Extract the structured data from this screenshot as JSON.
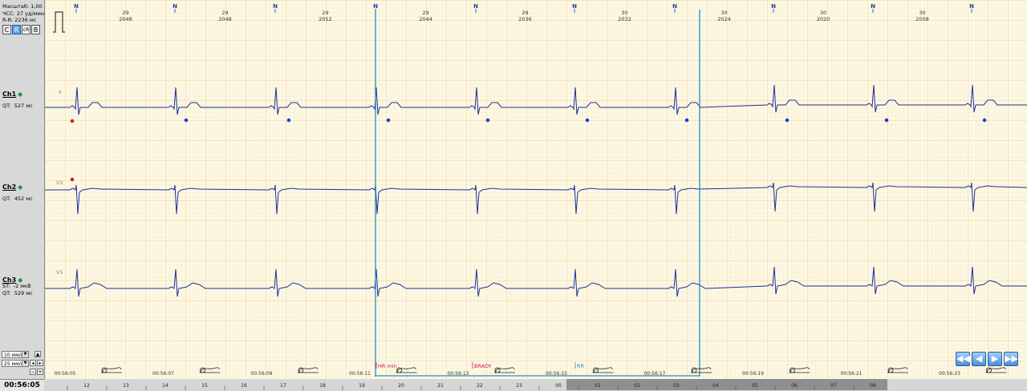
{
  "info": {
    "scale_label": "Масштаб:",
    "scale_value": "1,00",
    "hr_label": "ЧСС:",
    "hr_value": "27",
    "hr_unit": "уд/мин",
    "rr_label": "R-R:",
    "rr_value": "2236",
    "rr_unit": "мс"
  },
  "mode_buttons": [
    "C",
    "R",
    "cR",
    "B"
  ],
  "channels": [
    {
      "name": "Ch1",
      "lead": "II",
      "meas": [
        {
          "label": "QT:",
          "value": "527",
          "unit": "мс"
        }
      ]
    },
    {
      "name": "Ch2",
      "lead": "V2",
      "meas": [
        {
          "label": "QT:",
          "value": "452",
          "unit": "мс"
        }
      ]
    },
    {
      "name": "Ch3",
      "lead": "V5",
      "meas": [
        {
          "label": "ST:",
          "value": "-2",
          "unit": "мкВ"
        },
        {
          "label": "QT:",
          "value": "529",
          "unit": "мс"
        }
      ]
    }
  ],
  "gain_select": "10 мм/мВ",
  "speed_select": "25 мм/с",
  "current_time": "00:56:05",
  "beats": [
    {
      "label": "N",
      "hr": "29",
      "rr": "2048"
    },
    {
      "label": "N",
      "hr": "29",
      "rr": "2048"
    },
    {
      "label": "N",
      "hr": "29",
      "rr": "2052"
    },
    {
      "label": "N",
      "hr": "29",
      "rr": "2044"
    },
    {
      "label": "N",
      "hr": "29",
      "rr": "2036"
    },
    {
      "label": "N",
      "hr": "30",
      "rr": "2032"
    },
    {
      "label": "N",
      "hr": "30",
      "rr": "2024"
    },
    {
      "label": "N",
      "hr": "30",
      "rr": "2020"
    },
    {
      "label": "N",
      "hr": "30",
      "rr": "2008"
    },
    {
      "label": "N",
      "hr": "",
      "rr": ""
    }
  ],
  "time_ticks": [
    "00:56:05",
    "00:56:07",
    "00:56:09",
    "00:56:11",
    "00:56:13",
    "00:56:15",
    "00:56:17",
    "00:56:19",
    "00:56:21",
    "00:56:23"
  ],
  "events": [
    "HR min",
    "BRADY",
    "RR"
  ],
  "overview_ticks": [
    "12",
    "13",
    "14",
    "15",
    "16",
    "17",
    "18",
    "19",
    "20",
    "21",
    "22",
    "23",
    "00",
    "01",
    "02",
    "03",
    "04",
    "05",
    "06",
    "07",
    "08"
  ],
  "colors": {
    "grid_bg": "#fdf8e4",
    "grid_minor": "#f3e3b4",
    "grid_major": "#e6c98a",
    "trace": "#1c2f9c",
    "marker_blue": "#1a3de0",
    "marker_red": "#e11b1b",
    "selection": "#1b8fd0",
    "event_pink": "#c2186b"
  }
}
